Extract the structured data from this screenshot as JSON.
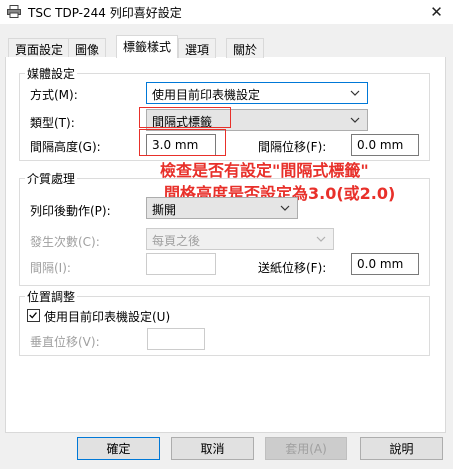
{
  "window": {
    "title": "TSC TDP-244 列印喜好設定",
    "close_glyph": "✕"
  },
  "tabs": [
    {
      "label": "頁面設定"
    },
    {
      "label": "圖像"
    },
    {
      "label": "標籤樣式",
      "active": true
    },
    {
      "label": "選項"
    },
    {
      "label": "關於"
    }
  ],
  "media": {
    "legend": "媒體設定",
    "method_label": "方式(M):",
    "method_value": "使用目前印表機設定",
    "type_label": "類型(T):",
    "type_value": "間隔式標籤",
    "gap_height_label": "間隔高度(G):",
    "gap_height_value": "3.0 mm",
    "gap_offset_label": "間隔位移(F):",
    "gap_offset_value": "0.0 mm"
  },
  "annotation": {
    "line1": "檢查是否有設定\"間隔式標籤\"",
    "line2": "間格高度是否設定為3.0(或2.0)"
  },
  "post": {
    "legend": "介質處理",
    "action_label": "列印後動作(P):",
    "action_value": "撕開",
    "occurrence_label": "發生次數(C):",
    "occurrence_value": "每頁之後",
    "interval_label": "間隔(I):",
    "interval_value": "",
    "feed_offset_label": "送紙位移(F):",
    "feed_offset_value": "0.0 mm"
  },
  "position": {
    "legend": "位置調整",
    "checkbox_label": "使用目前印表機設定(U)",
    "checked": true,
    "vertical_label": "垂直位移(V):",
    "vertical_value": ""
  },
  "buttons": {
    "ok": "確定",
    "cancel": "取消",
    "apply": "套用(A)",
    "help": "說明"
  },
  "colors": {
    "annotation": "#e8302a",
    "focus": "#0078d7"
  }
}
